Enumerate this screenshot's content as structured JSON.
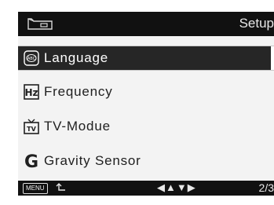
{
  "header": {
    "mode_icon": "movie-frame-icon",
    "title": "Setup"
  },
  "menu": {
    "items": [
      {
        "label": "Language",
        "icon": "language-abc-icon",
        "selected": true
      },
      {
        "label": "Frequency",
        "icon": "hz-icon",
        "selected": false
      },
      {
        "label": "TV-Modue",
        "icon": "tv-icon",
        "selected": false
      },
      {
        "label": "Gravity Sensor",
        "icon": "gravity-g-icon",
        "selected": false
      }
    ]
  },
  "footer": {
    "menu_button_label": "MENU",
    "back_icon": "return-arrow-icon",
    "nav_arrows": "◀▲▼▶",
    "page_indicator": "2/3"
  },
  "colors": {
    "bar_background": "#111111",
    "screen_background": "#f3f3f3",
    "selected_background": "#262626"
  }
}
